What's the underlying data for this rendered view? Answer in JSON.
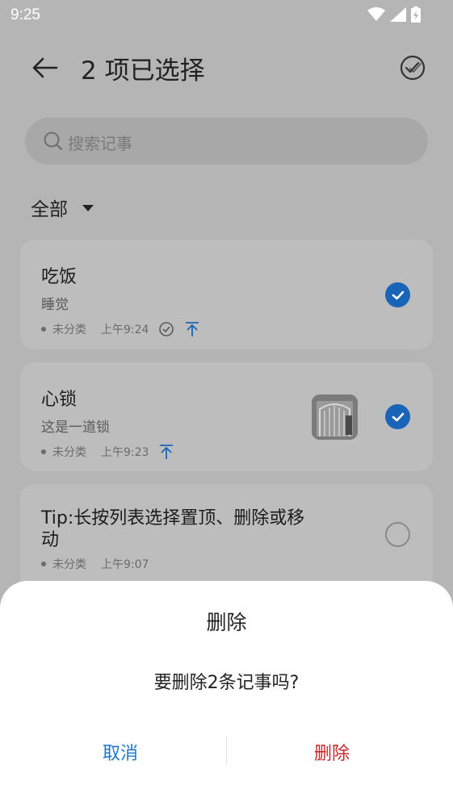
{
  "status_bar": {
    "time": "9:25"
  },
  "header": {
    "title": "2 项已选择"
  },
  "search": {
    "placeholder": "搜索记事"
  },
  "filter": {
    "label": "全部"
  },
  "notes": [
    {
      "title": "吃饭",
      "body": "睡觉",
      "category": "未分类",
      "time": "上午9:24",
      "selected": true
    },
    {
      "title": "心锁",
      "body": "这是一道锁",
      "category": "未分类",
      "time": "上午9:23",
      "selected": true
    },
    {
      "title_line1": "Tip:长按列表选择置顶、删除或移",
      "title_line2": "动",
      "category": "未分类",
      "time": "上午9:07",
      "selected": false
    }
  ],
  "dialog": {
    "title": "删除",
    "message": "要删除2条记事吗?",
    "cancel_label": "取消",
    "confirm_label": "删除"
  },
  "colors": {
    "accent": "#1a64b8",
    "danger": "#c9252b",
    "link": "#1f78d1"
  }
}
